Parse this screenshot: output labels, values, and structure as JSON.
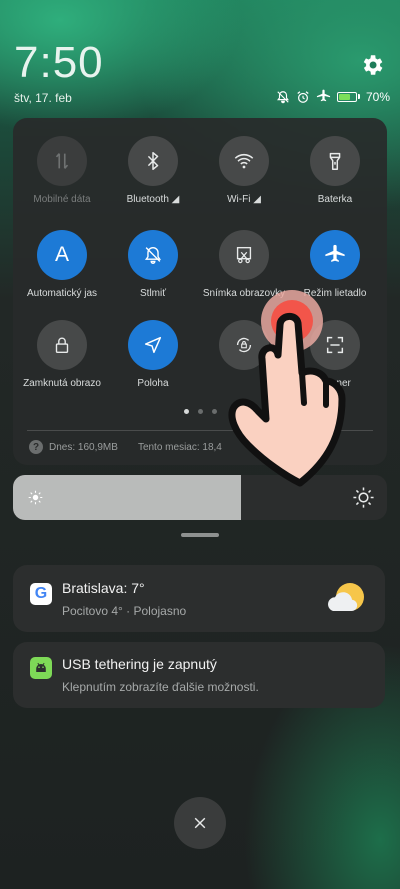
{
  "status_bar": {
    "time": "7:50",
    "date": "štv, 17. feb",
    "battery_percent": "70%",
    "battery_level": 0.7,
    "icons": [
      "silent-bell-icon",
      "alarm-icon",
      "airplane-icon",
      "battery-charging-icon"
    ]
  },
  "quick_settings": {
    "tiles": [
      {
        "label": "Mobilné dáta",
        "icon": "mobile-data-icon",
        "state": "disabled"
      },
      {
        "label": "Bluetooth ◢",
        "icon": "bluetooth-icon",
        "state": "off"
      },
      {
        "label": "Wi-Fi ◢",
        "icon": "wifi-icon",
        "state": "off"
      },
      {
        "label": "Baterka",
        "icon": "flashlight-icon",
        "state": "off"
      },
      {
        "label": "Automatický jas",
        "icon": "auto-brightness-icon",
        "state": "on"
      },
      {
        "label": "Stlmiť",
        "icon": "mute-bell-icon",
        "state": "on"
      },
      {
        "label": "Snímka obrazovky",
        "icon": "screenshot-icon",
        "state": "off"
      },
      {
        "label": "Režim lietadlo",
        "icon": "airplane-icon",
        "state": "on"
      },
      {
        "label": "Zamknutá obrazo",
        "icon": "lock-icon",
        "state": "off"
      },
      {
        "label": "Poloha",
        "icon": "location-icon",
        "state": "on"
      },
      {
        "label": "",
        "icon": "rotation-lock-icon",
        "state": "off"
      },
      {
        "label": "Skener",
        "icon": "scanner-icon",
        "state": "off"
      }
    ],
    "auto_brightness_letter": "A",
    "page_count": 3,
    "current_page": 1,
    "data_usage": {
      "today": "Dnes: 160,9MB",
      "month": "Tento mesiac: 18,4"
    }
  },
  "brightness": {
    "level": 0.61
  },
  "notifications": [
    {
      "app_icon": "google-icon",
      "title": "Bratislava: 7°",
      "text": "Pocitovo 4° · Polojasno",
      "trailing_icon": "partly-cloudy-icon"
    },
    {
      "app_icon": "android-icon",
      "title": "USB tethering je zapnutý",
      "text": "Klepnutím zobrazíte ďalšie možnosti."
    }
  ],
  "colors": {
    "accent": "#1d7ad6",
    "tile_off": "#474949",
    "tap_indicator": "#f2554a",
    "google_blue": "#4285f4",
    "android_green": "#7ed957"
  }
}
